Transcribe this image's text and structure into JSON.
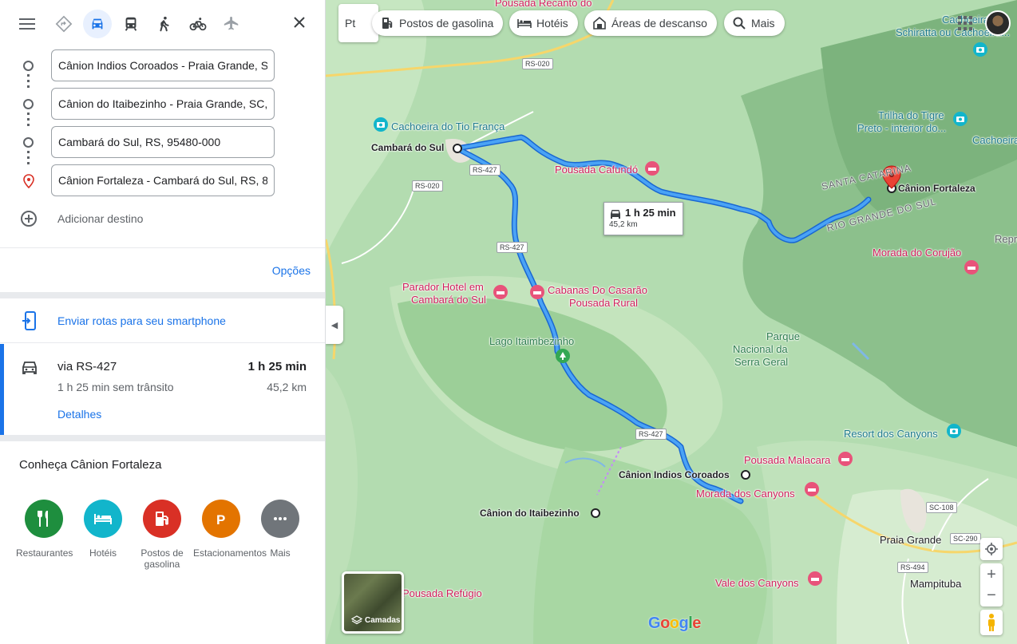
{
  "travel_modes": [
    "best-route",
    "driving",
    "transit",
    "walking",
    "cycling",
    "flight"
  ],
  "stops": [
    {
      "value": "Cânion Indios Coroados - Praia Grande, S",
      "type": "origin"
    },
    {
      "value": "Cânion do Itaibezinho - Praia Grande, SC,",
      "type": "waypoint"
    },
    {
      "value": "Cambará do Sul, RS, 95480-000",
      "type": "waypoint"
    },
    {
      "value": "Cânion Fortaleza - Cambará do Sul, RS, 8",
      "type": "destination"
    }
  ],
  "add_destination": "Adicionar destino",
  "options_label": "Opções",
  "send_label": "Enviar rotas para seu smartphone",
  "route": {
    "via": "via RS-427",
    "time": "1 h 25 min",
    "traffic": "1 h 25 min sem trânsito",
    "distance": "45,2 km",
    "details": "Detalhes"
  },
  "explore": {
    "title": "Conheça Cânion Fortaleza",
    "categories": [
      {
        "label": "Restaurantes",
        "color": "#1e8e3e",
        "icon": "restaurant-icon"
      },
      {
        "label": "Hotéis",
        "color": "#12b5cb",
        "icon": "hotel-icon"
      },
      {
        "label": "Postos de gasolina",
        "color": "#d93025",
        "icon": "gas-station-icon"
      },
      {
        "label": "Estacionamentos",
        "color": "#e37400",
        "icon": "parking-icon"
      },
      {
        "label": "Mais",
        "color": "#70757a",
        "icon": "more-icon"
      }
    ]
  },
  "map": {
    "pt_button": "Pt",
    "chips": [
      {
        "label": "Postos de gasolina",
        "icon": "gas-station-icon"
      },
      {
        "label": "Hotéis",
        "icon": "hotel-icon"
      },
      {
        "label": "Áreas de descanso",
        "icon": "rest-area-icon"
      },
      {
        "label": "Mais",
        "icon": "search-icon"
      }
    ],
    "info_box": {
      "time": "1 h 25 min",
      "distance": "45,2 km"
    },
    "layers_label": "Camadas",
    "labels": {
      "pousada_recanto": "Pousada Recanto do",
      "cachoeira_tio": "Cachoeira do Tio França",
      "cambara": "Cambará do Sul",
      "pousada_cafundo": "Pousada Cafundó",
      "parador_1": "Parador Hotel em",
      "parador_2": "Cambará do Sul",
      "cabanas_1": "Cabanas Do Casarão",
      "cabanas_2": "Pousada Rural",
      "lago": "Lago Itaimbezinho",
      "parque_1": "Parque",
      "parque_2": "Nacional da",
      "parque_3": "Serra Geral",
      "canion_coroados": "Cânion Indios Coroados",
      "canion_itaibezinho": "Cânion do Itaibezinho",
      "pousada_malacara": "Pousada Malacara",
      "morada_canyons": "Morada dos Canyons",
      "resort": "Resort dos Canyons",
      "praia_grande": "Praia Grande",
      "mampituba": "Mampituba",
      "vale_canyons": "Vale dos Canyons",
      "pousada_refugio": "Pousada Refúgio",
      "canion_fortaleza": "Cânion Fortaleza",
      "trilha_1": "Trilha do Tigre",
      "trilha_2": "Preto - interior do...",
      "cachoeira_right": "Cachoeira",
      "cachoeira_top_1": "Cachoeira",
      "cachoeira_top_2": "Schiratta ou Cachoeira...",
      "morada_corujao": "Morada do Corujão",
      "santa_catarina": "SANTA CATARINA",
      "rio_grande": "RIO GRANDE DO SUL",
      "repres": "Repres"
    },
    "roads": [
      "RS-020",
      "RS-427",
      "RS-020",
      "RS-427",
      "RS-427",
      "SC-108",
      "SC-290",
      "RS-494"
    ]
  }
}
